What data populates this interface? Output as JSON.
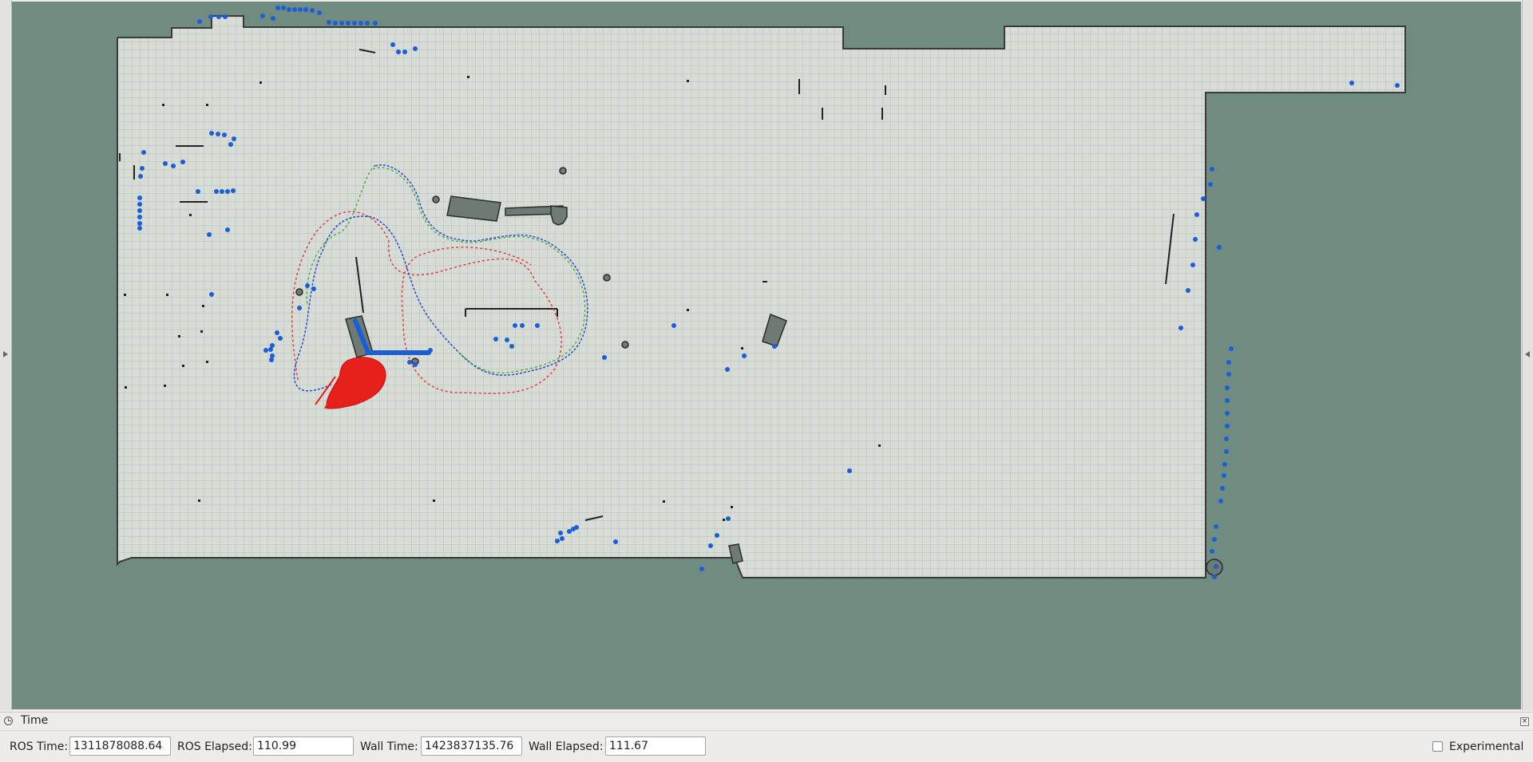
{
  "time_panel": {
    "title": "Time",
    "ros_time": {
      "label": "ROS Time:",
      "value": "1311878088.64"
    },
    "ros_elapsed": {
      "label": "ROS Elapsed:",
      "value": "110.99"
    },
    "wall_time": {
      "label": "Wall Time:",
      "value": "1423837135.76"
    },
    "wall_elapsed": {
      "label": "Wall Elapsed:",
      "value": "111.67"
    },
    "experimental": {
      "label": "Experimental",
      "checked": false
    }
  },
  "colors": {
    "unknown_space": "#708b80",
    "free_space": "#d7dcd6",
    "grid_line": "#b8bfb7",
    "laser_points": "#1b5fd8",
    "global_plan": "#2a48c8",
    "local_plan": "#2aa82a",
    "planned_path": "#e03a4a",
    "particle_cloud": "#e8201c"
  }
}
